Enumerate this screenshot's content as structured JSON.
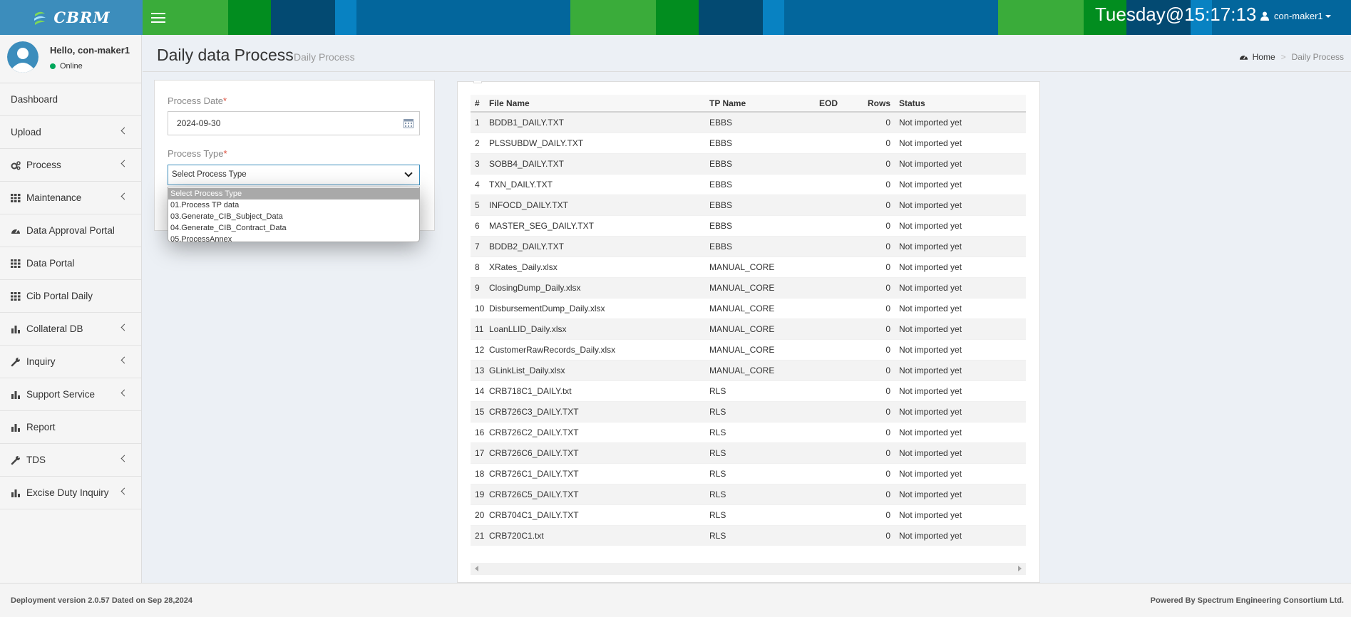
{
  "header": {
    "logo_text": "CBRM",
    "clock": "Tuesday@15:17:13",
    "user": "con-maker1"
  },
  "sidebar": {
    "user_greeting": "Hello, con-maker1",
    "status": "Online",
    "items": [
      {
        "label": "Dashboard",
        "icon": "none",
        "has_submenu": false
      },
      {
        "label": "Upload",
        "icon": "none",
        "has_submenu": true
      },
      {
        "label": "Process",
        "icon": "gears-icon",
        "has_submenu": true
      },
      {
        "label": "Maintenance",
        "icon": "grid-icon",
        "has_submenu": true
      },
      {
        "label": "Data Approval Portal",
        "icon": "dashboard-icon",
        "has_submenu": false
      },
      {
        "label": "Data Portal",
        "icon": "grid-icon",
        "has_submenu": false
      },
      {
        "label": "Cib Portal Daily",
        "icon": "grid-icon",
        "has_submenu": false
      },
      {
        "label": "Collateral DB",
        "icon": "bar-chart-icon",
        "has_submenu": true
      },
      {
        "label": "Inquiry",
        "icon": "wrench-icon",
        "has_submenu": true
      },
      {
        "label": "Support Service",
        "icon": "bar-chart-icon",
        "has_submenu": true
      },
      {
        "label": "Report",
        "icon": "bar-chart-icon",
        "has_submenu": false
      },
      {
        "label": "TDS",
        "icon": "wrench-icon",
        "has_submenu": true
      },
      {
        "label": "Excise Duty Inquiry",
        "icon": "bar-chart-icon",
        "has_submenu": true
      }
    ]
  },
  "page": {
    "title": "Daily data Process",
    "subtitle": "Daily Process",
    "breadcrumb_home": "Home",
    "breadcrumb_current": "Daily Process"
  },
  "form": {
    "date_label": "Process Date",
    "date_value": "2024-09-30",
    "type_label": "Process Type",
    "required_mark": "*",
    "type_selected": "Select Process Type",
    "type_options": [
      "Select Process Type",
      "01.Process TP data",
      "03.Generate_CIB_Subject_Data",
      "04.Generate_CIB_Contract_Data",
      "05.ProcessAnnex"
    ]
  },
  "table": {
    "columns": [
      "#",
      "File Name",
      "TP Name",
      "EOD",
      "Rows",
      "Status"
    ],
    "rows": [
      [
        "1",
        "BDDB1_DAILY.TXT",
        "EBBS",
        "",
        "0",
        "Not imported yet"
      ],
      [
        "2",
        "PLSSUBDW_DAILY.TXT",
        "EBBS",
        "",
        "0",
        "Not imported yet"
      ],
      [
        "3",
        "SOBB4_DAILY.TXT",
        "EBBS",
        "",
        "0",
        "Not imported yet"
      ],
      [
        "4",
        "TXN_DAILY.TXT",
        "EBBS",
        "",
        "0",
        "Not imported yet"
      ],
      [
        "5",
        "INFOCD_DAILY.TXT",
        "EBBS",
        "",
        "0",
        "Not imported yet"
      ],
      [
        "6",
        "MASTER_SEG_DAILY.TXT",
        "EBBS",
        "",
        "0",
        "Not imported yet"
      ],
      [
        "7",
        "BDDB2_DAILY.TXT",
        "EBBS",
        "",
        "0",
        "Not imported yet"
      ],
      [
        "8",
        "XRates_Daily.xlsx",
        "MANUAL_CORE",
        "",
        "0",
        "Not imported yet"
      ],
      [
        "9",
        "ClosingDump_Daily.xlsx",
        "MANUAL_CORE",
        "",
        "0",
        "Not imported yet"
      ],
      [
        "10",
        "DisbursementDump_Daily.xlsx",
        "MANUAL_CORE",
        "",
        "0",
        "Not imported yet"
      ],
      [
        "11",
        "LoanLLID_Daily.xlsx",
        "MANUAL_CORE",
        "",
        "0",
        "Not imported yet"
      ],
      [
        "12",
        "CustomerRawRecords_Daily.xlsx",
        "MANUAL_CORE",
        "",
        "0",
        "Not imported yet"
      ],
      [
        "13",
        "GLinkList_Daily.xlsx",
        "MANUAL_CORE",
        "",
        "0",
        "Not imported yet"
      ],
      [
        "14",
        "CRB718C1_DAILY.txt",
        "RLS",
        "",
        "0",
        "Not imported yet"
      ],
      [
        "15",
        "CRB726C3_DAILY.TXT",
        "RLS",
        "",
        "0",
        "Not imported yet"
      ],
      [
        "16",
        "CRB726C2_DAILY.TXT",
        "RLS",
        "",
        "0",
        "Not imported yet"
      ],
      [
        "17",
        "CRB726C6_DAILY.TXT",
        "RLS",
        "",
        "0",
        "Not imported yet"
      ],
      [
        "18",
        "CRB726C1_DAILY.TXT",
        "RLS",
        "",
        "0",
        "Not imported yet"
      ],
      [
        "19",
        "CRB726C5_DAILY.TXT",
        "RLS",
        "",
        "0",
        "Not imported yet"
      ],
      [
        "20",
        "CRB704C1_DAILY.TXT",
        "RLS",
        "",
        "0",
        "Not imported yet"
      ],
      [
        "21",
        "CRB720C1.txt",
        "RLS",
        "",
        "0",
        "Not imported yet"
      ]
    ]
  },
  "footer": {
    "left": "Deployment version 2.0.57 Dated on Sep 28,2024",
    "right": "Powered By Spectrum Engineering Consortium Ltd."
  },
  "colors": {
    "header_blue": "#03669c",
    "header_green": "#3aac3a",
    "accent": "#3c8dbc",
    "online": "#00a65a",
    "required": "#dd4b39"
  }
}
